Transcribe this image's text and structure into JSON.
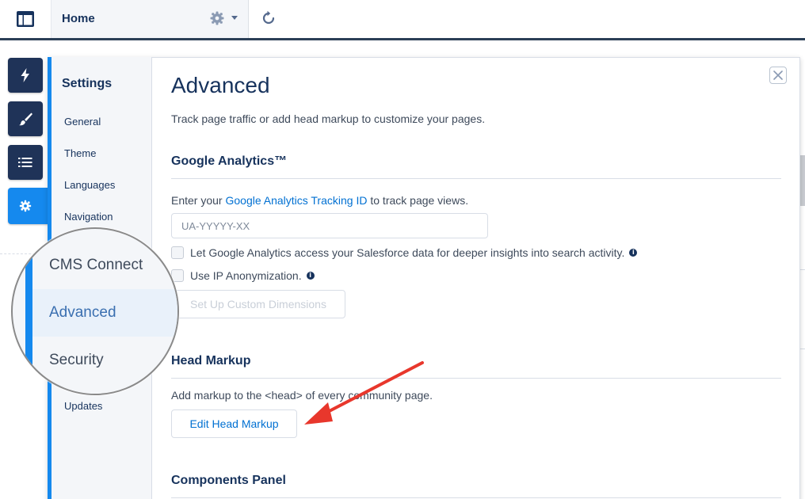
{
  "topbar": {
    "home_label": "Home",
    "icons": {
      "panel": "panel-layout-icon",
      "gear": "gear-icon",
      "caret": "caret-down-icon",
      "refresh": "refresh-icon"
    }
  },
  "tools": [
    {
      "icon": "lightning-icon"
    },
    {
      "icon": "brush-icon"
    },
    {
      "icon": "list-icon"
    },
    {
      "icon": "gear-icon",
      "active": true
    }
  ],
  "nav": {
    "title": "Settings",
    "items": [
      {
        "label": "General"
      },
      {
        "label": "Theme"
      },
      {
        "label": "Languages"
      },
      {
        "label": "Navigation"
      },
      {
        "label": "CMS Connect"
      },
      {
        "label": "Advanced",
        "active": true
      },
      {
        "label": "Security"
      },
      {
        "label": "Updates"
      }
    ]
  },
  "main": {
    "title": "Advanced",
    "description": "Track page traffic or add head markup to customize your pages.",
    "google_analytics": {
      "title": "Google Analytics™",
      "intro_prefix": "Enter your ",
      "intro_link": "Google Analytics Tracking ID",
      "intro_suffix": " to track page views.",
      "input_placeholder": "UA-YYYYY-XX",
      "checkbox_salesforce": "Let Google Analytics access your Salesforce data for deeper insights into search activity.",
      "checkbox_anonymize": "Use IP Anonymization.",
      "custom_dimensions_button": "Set Up Custom Dimensions"
    },
    "head_markup": {
      "title": "Head Markup",
      "description": "Add markup to the <head> of every community page.",
      "button": "Edit Head Markup"
    },
    "components_panel": {
      "title": "Components Panel"
    }
  },
  "colors": {
    "accent": "#1589ee",
    "navy": "#1f3358",
    "link": "#0070d2",
    "annotation_arrow": "#e8372c"
  }
}
